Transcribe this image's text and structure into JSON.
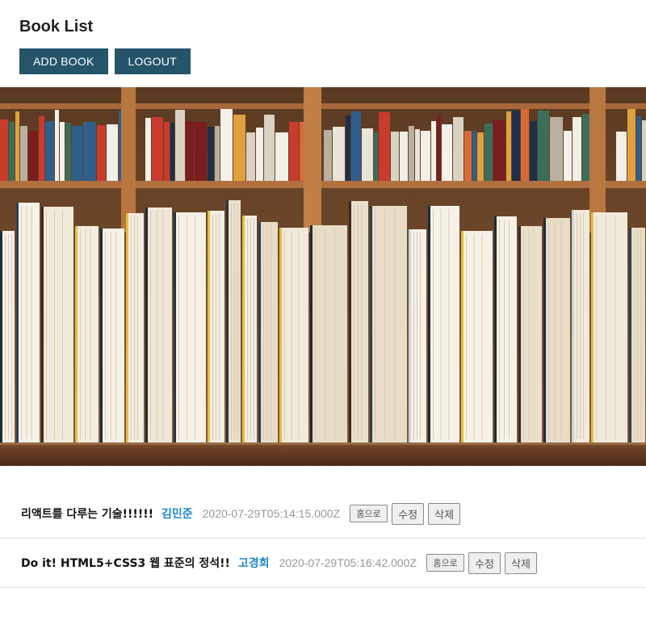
{
  "header": {
    "title": "Book List",
    "add_label": "ADD BOOK",
    "logout_label": "LOGOUT"
  },
  "colors": {
    "primary_button": "#25546b",
    "author_link": "#1c88c9",
    "date_text": "#999999"
  },
  "books": [
    {
      "title": "리액트를 다루는 기술!!!!!!",
      "author": "김민준",
      "created_at": "2020-07-29T05:14:15.000Z",
      "home_label": "홈으로",
      "edit_label": "수정",
      "delete_label": "삭제"
    },
    {
      "title": "Do it! HTML5+CSS3 웹 표준의 정석!!",
      "author": "고경희",
      "created_at": "2020-07-29T05:16:42.000Z",
      "home_label": "홈으로",
      "edit_label": "수정",
      "delete_label": "삭제"
    }
  ]
}
